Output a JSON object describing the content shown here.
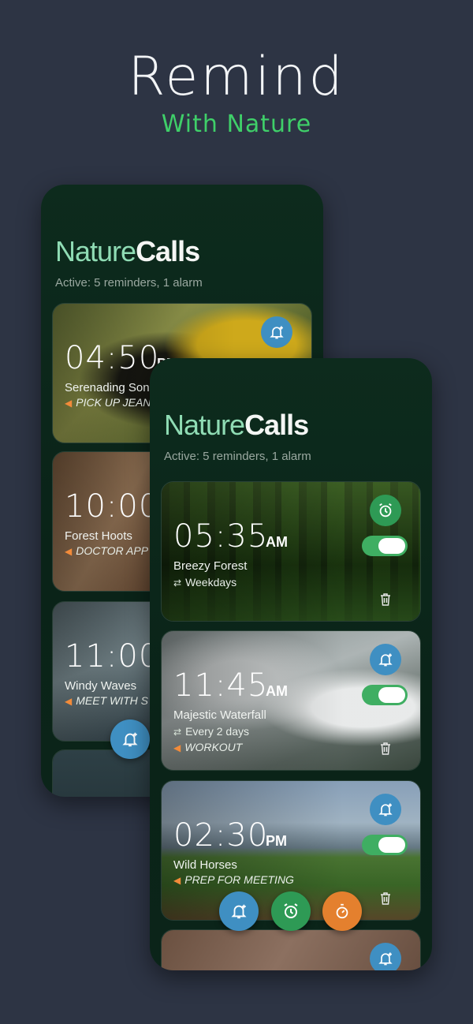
{
  "hero": {
    "title": "Remind",
    "subtitle": "With Nature"
  },
  "colors": {
    "accent_green": "#3fcf69",
    "reminder_blue": "#3f8fc2",
    "alarm_green": "#2e9a55",
    "timer_orange": "#e4802e",
    "background": "#2d3444"
  },
  "back_phone": {
    "brand_light": "Nature",
    "brand_bold": "Calls",
    "active_text": "Active:  5 reminders, 1 alarm",
    "cards": [
      {
        "time": "04:50",
        "ampm": "PM",
        "label": "Serenading Song",
        "task": "PICK UP JEAN",
        "badge_icon": "bell-plus-icon"
      },
      {
        "time": "10:00",
        "label": "Forest Hoots",
        "task": "DOCTOR APP"
      },
      {
        "time": "11:00",
        "label": "Windy Waves",
        "task": "MEET WITH S"
      }
    ]
  },
  "front_phone": {
    "brand_light": "Nature",
    "brand_bold": "Calls",
    "active_text": "Active:  5 reminders, 1 alarm",
    "cards": [
      {
        "time": "05:35",
        "ampm": "AM",
        "label": "Breezy Forest",
        "repeat": "Weekdays",
        "badge_icon": "alarm-clock-icon",
        "enabled": true
      },
      {
        "time": "11:45",
        "ampm": "AM",
        "label": "Majestic Waterfall",
        "repeat": "Every 2 days",
        "task": "WORKOUT",
        "badge_icon": "bell-plus-icon",
        "enabled": true
      },
      {
        "time": "02:30",
        "ampm": "PM",
        "label": "Wild Horses",
        "task": "PREP FOR MEETING",
        "badge_icon": "bell-plus-icon",
        "enabled": true
      }
    ],
    "fabs": [
      "bell-plus-icon",
      "alarm-clock-icon",
      "timer-icon"
    ]
  }
}
